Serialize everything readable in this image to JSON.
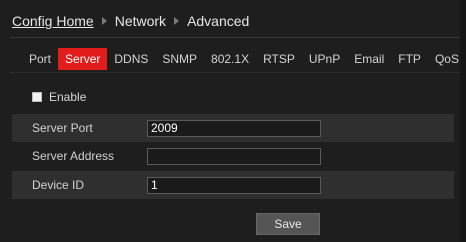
{
  "breadcrumb": {
    "home": "Config Home",
    "items": [
      "Network",
      "Advanced"
    ]
  },
  "tabs": [
    {
      "label": "Port"
    },
    {
      "label": "Server",
      "active": true
    },
    {
      "label": "DDNS"
    },
    {
      "label": "SNMP"
    },
    {
      "label": "802.1X"
    },
    {
      "label": "RTSP"
    },
    {
      "label": "UPnP"
    },
    {
      "label": "Email"
    },
    {
      "label": "FTP"
    },
    {
      "label": "QoS"
    }
  ],
  "enable": {
    "label": "Enable",
    "checked": false
  },
  "form": {
    "server_port": {
      "label": "Server Port",
      "value": "2009"
    },
    "server_address": {
      "label": "Server Address",
      "value": ""
    },
    "device_id": {
      "label": "Device ID",
      "value": "1"
    }
  },
  "save_label": "Save",
  "colors": {
    "accent": "#e21b1b",
    "background": "#1e1e1e",
    "row_shade": "#2f2f2f"
  }
}
